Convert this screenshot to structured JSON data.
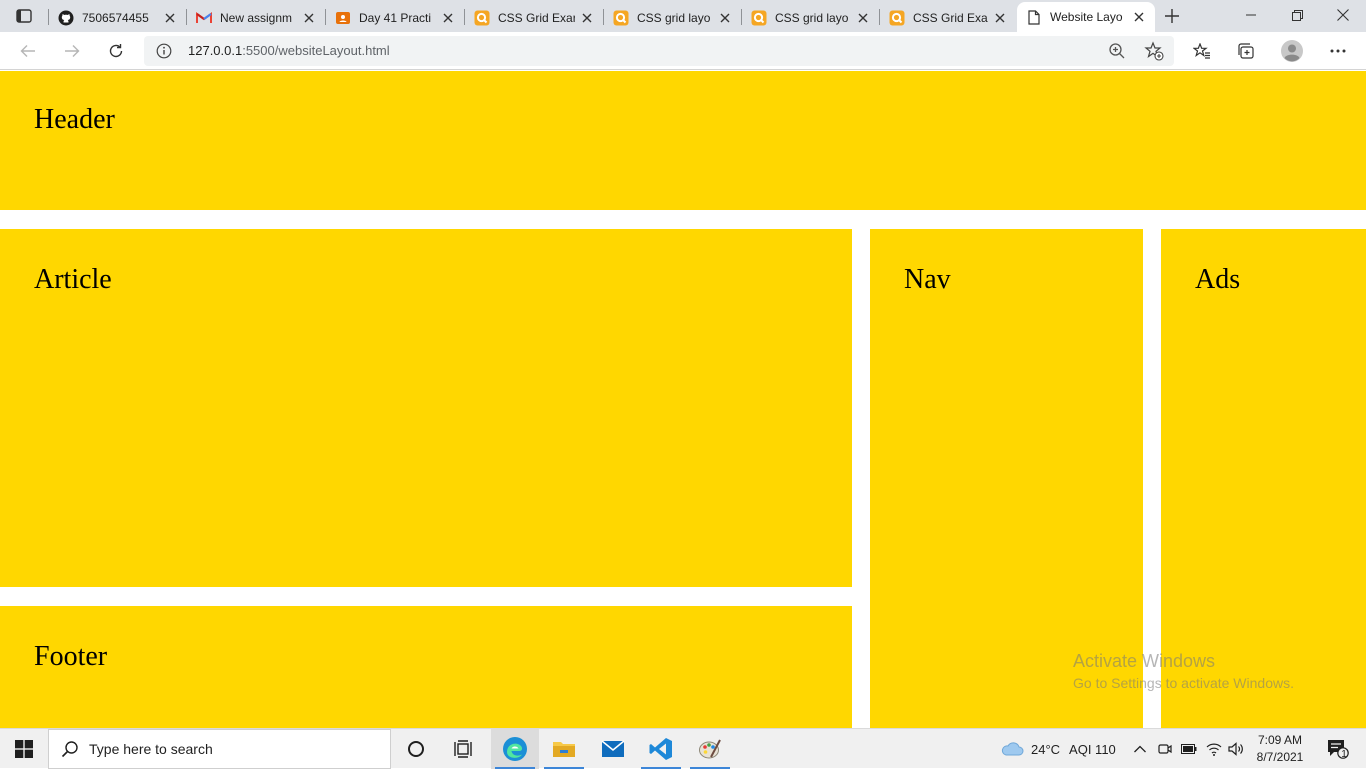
{
  "browser": {
    "tabs": [
      {
        "title": "7506574455",
        "favicon": "github-icon"
      },
      {
        "title": "New assignm",
        "favicon": "gmail-icon"
      },
      {
        "title": "Day 41 Practi",
        "favicon": "classroom-icon"
      },
      {
        "title": "CSS Grid Exar",
        "favicon": "search-engine-icon"
      },
      {
        "title": "CSS grid layo",
        "favicon": "search-engine-icon"
      },
      {
        "title": "CSS grid layo",
        "favicon": "search-engine-icon"
      },
      {
        "title": "CSS Grid Exar",
        "favicon": "search-engine-icon"
      },
      {
        "title": "Website Layo",
        "favicon": "page-icon",
        "active": true
      }
    ],
    "address": {
      "host": "127.0.0.1",
      "path": ":5500/websiteLayout.html"
    }
  },
  "page": {
    "header": "Header",
    "article": "Article",
    "nav": "Nav",
    "ads": "Ads",
    "footer": "Footer",
    "block_color": "#ffd700"
  },
  "watermark": {
    "line1": "Activate Windows",
    "line2": "Go to Settings to activate Windows."
  },
  "taskbar": {
    "search_placeholder": "Type here to search",
    "weather": "24°C",
    "aqi": "AQI 110",
    "time": "7:09 AM",
    "date": "8/7/2021",
    "notification_count": "1"
  }
}
